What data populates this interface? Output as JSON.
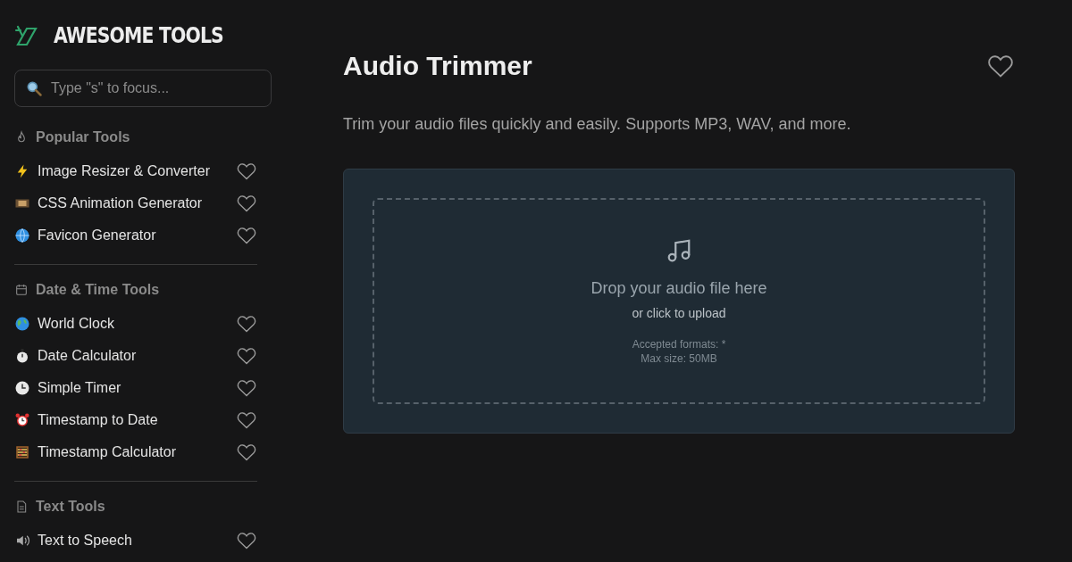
{
  "brand": {
    "name": "AWESOME TOOLS"
  },
  "search": {
    "placeholder": "Type \"s\" to focus..."
  },
  "sections": [
    {
      "title": "Popular Tools",
      "items": [
        {
          "label": "Image Resizer & Converter",
          "favorite": false
        },
        {
          "label": "CSS Animation Generator",
          "favorite": false
        },
        {
          "label": "Favicon Generator",
          "favorite": false
        }
      ]
    },
    {
      "title": "Date & Time Tools",
      "items": [
        {
          "label": "World Clock",
          "favorite": false
        },
        {
          "label": "Date Calculator",
          "favorite": false
        },
        {
          "label": "Simple Timer",
          "favorite": false
        },
        {
          "label": "Timestamp to Date",
          "favorite": false
        },
        {
          "label": "Timestamp Calculator",
          "favorite": false
        }
      ]
    },
    {
      "title": "Text Tools",
      "items": [
        {
          "label": "Text to Speech",
          "favorite": false
        }
      ]
    }
  ],
  "page": {
    "title": "Audio Trimmer",
    "favorite": false,
    "description": "Trim your audio files quickly and easily. Supports MP3, WAV, and more."
  },
  "dropzone": {
    "title": "Drop your audio file here",
    "subtitle": "or click to upload",
    "formats": "Accepted formats: *",
    "max_size": "Max size: 50MB"
  }
}
